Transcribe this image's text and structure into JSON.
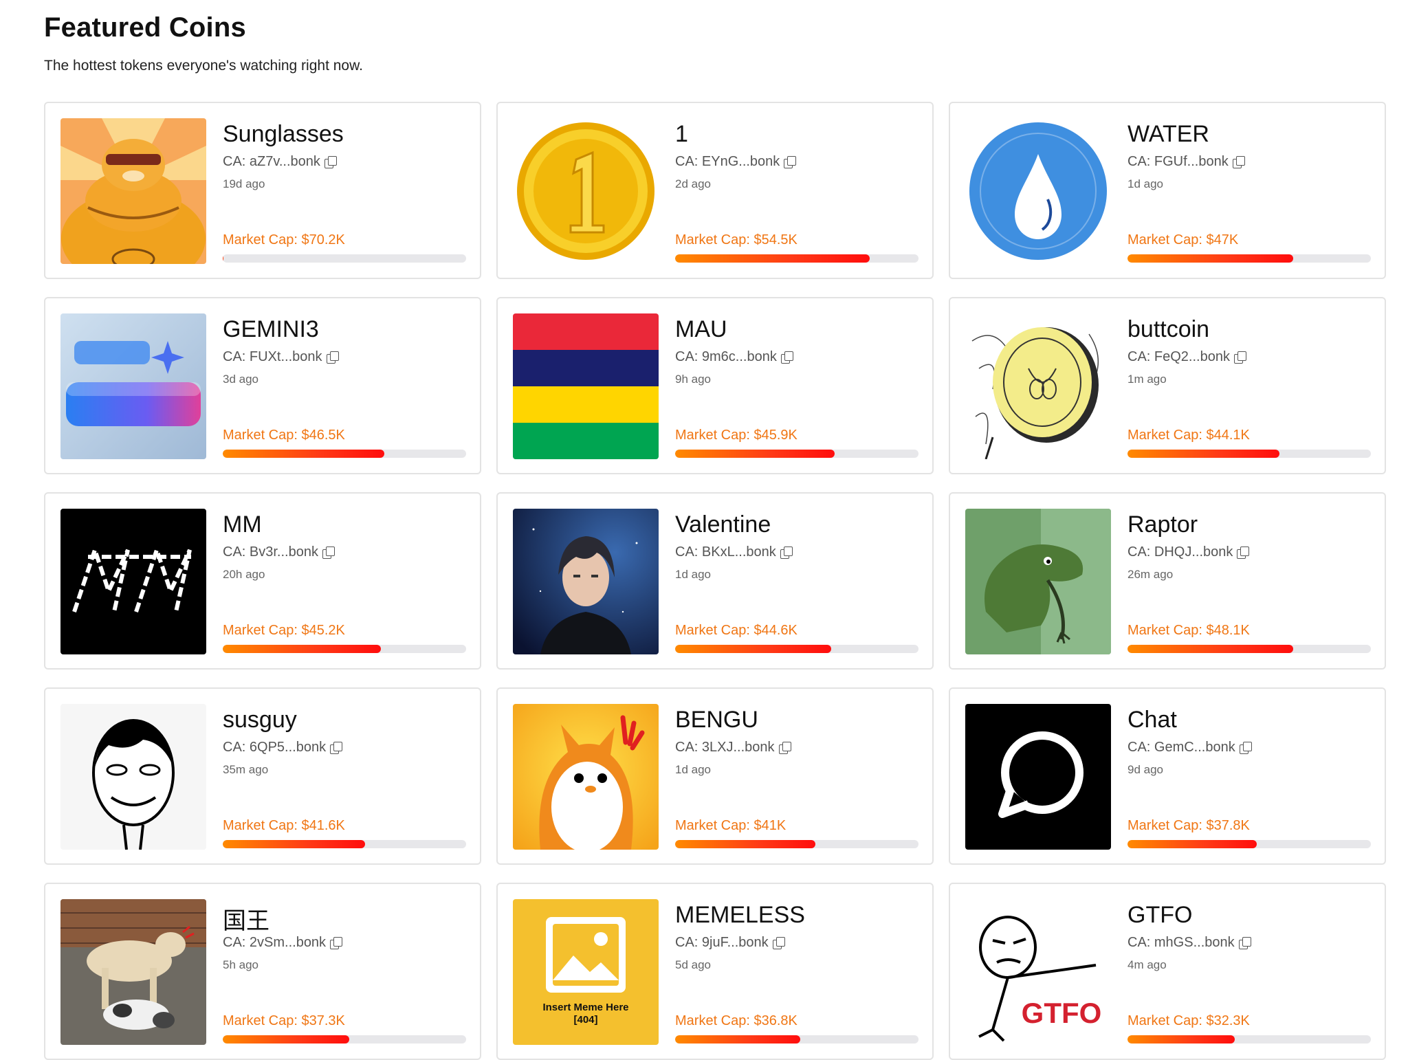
{
  "header": {
    "title": "Featured Coins",
    "subtitle": "The hottest tokens everyone's watching right now."
  },
  "coins": [
    {
      "name": "Sunglasses",
      "ca": "CA: aZ7v...bonk",
      "age": "19d ago",
      "market_cap": "Market Cap: $70.2K",
      "progress": 0.003,
      "icon": "orange-cat-sunglasses-icon"
    },
    {
      "name": "1",
      "ca": "CA: EYnG...bonk",
      "age": "2d ago",
      "market_cap": "Market Cap: $54.5K",
      "progress": 0.8,
      "icon": "gold-coin-one-icon"
    },
    {
      "name": "WATER",
      "ca": "CA: FGUf...bonk",
      "age": "1d ago",
      "market_cap": "Market Cap: $47K",
      "progress": 0.68,
      "icon": "team-water-drop-icon"
    },
    {
      "name": "GEMINI3",
      "ca": "CA: FUXt...bonk",
      "age": "3d ago",
      "market_cap": "Market Cap: $46.5K",
      "progress": 0.665,
      "icon": "google-gemini-logo-icon"
    },
    {
      "name": "MAU",
      "ca": "CA: 9m6c...bonk",
      "age": "9h ago",
      "market_cap": "Market Cap: $45.9K",
      "progress": 0.655,
      "icon": "mauritius-flag-icon"
    },
    {
      "name": "buttcoin",
      "ca": "CA: FeQ2...bonk",
      "age": "1m ago",
      "market_cap": "Market Cap: $44.1K",
      "progress": 0.625,
      "icon": "butt-coin-sketch-icon"
    },
    {
      "name": "MM",
      "ca": "CA: Bv3r...bonk",
      "age": "20h ago",
      "market_cap": "Market Cap: $45.2K",
      "progress": 0.65,
      "icon": "mm-logo-icon"
    },
    {
      "name": "Valentine",
      "ca": "CA: BKxL...bonk",
      "age": "1d ago",
      "market_cap": "Market Cap: $44.6K",
      "progress": 0.64,
      "icon": "anime-man-portrait-icon"
    },
    {
      "name": "Raptor",
      "ca": "CA: DHQJ...bonk",
      "age": "26m ago",
      "market_cap": "Market Cap: $48.1K",
      "progress": 0.68,
      "icon": "philosoraptor-icon"
    },
    {
      "name": "susguy",
      "ca": "CA: 6QP5...bonk",
      "age": "35m ago",
      "market_cap": "Market Cap: $41.6K",
      "progress": 0.585,
      "icon": "sus-face-meme-icon"
    },
    {
      "name": "BENGU",
      "ca": "CA: 3LXJ...bonk",
      "age": "1d ago",
      "market_cap": "Market Cap: $41K",
      "progress": 0.575,
      "icon": "penguin-cartoon-icon"
    },
    {
      "name": "Chat",
      "ca": "CA: GemC...bonk",
      "age": "9d ago",
      "market_cap": "Market Cap: $37.8K",
      "progress": 0.53,
      "icon": "chat-bubble-icon"
    },
    {
      "name": "国王",
      "ca": "CA: 2vSm...bonk",
      "age": "5h ago",
      "market_cap": "Market Cap: $37.3K",
      "progress": 0.52,
      "icon": "dogs-photo-icon"
    },
    {
      "name": "MEMELESS",
      "ca": "CA: 9juF...bonk",
      "age": "5d ago",
      "market_cap": "Market Cap: $36.8K",
      "progress": 0.515,
      "icon": "image-placeholder-icon",
      "thumb_caption_1": "Insert Meme Here",
      "thumb_caption_2": "[404]"
    },
    {
      "name": "GTFO",
      "ca": "CA: mhGS...bonk",
      "age": "4m ago",
      "market_cap": "Market Cap: $32.3K",
      "progress": 0.44,
      "icon": "gtfo-meme-icon",
      "thumb_caption_1": "GTFO"
    }
  ],
  "colors": {
    "market_cap_text": "#f07614",
    "bar_track": "#e7e7ea",
    "bar_gradient_start": "#ff8a00",
    "bar_gradient_end": "#ff0d0d",
    "card_border": "#e3e3e3"
  }
}
